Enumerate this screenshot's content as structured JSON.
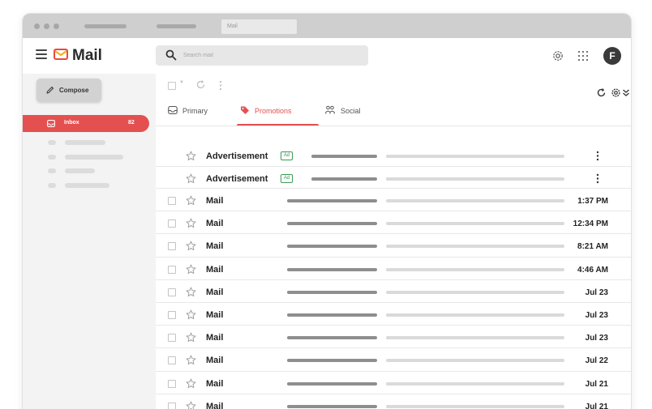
{
  "chrome": {
    "tab_title": "Mail"
  },
  "header": {
    "brand": "Mail",
    "search_placeholder": "Search mail",
    "avatar_letter": "F"
  },
  "sidebar": {
    "compose_label": "Compose",
    "inbox_label": "Inbox",
    "inbox_count": "82"
  },
  "tabs": [
    {
      "label": "Primary",
      "icon": "inbox-icon",
      "active": false
    },
    {
      "label": "Promotions",
      "icon": "tag-icon",
      "active": true
    },
    {
      "label": "Social",
      "icon": "people-icon",
      "active": false
    }
  ],
  "emails": [
    {
      "sender": "Advertisement",
      "ad_badge": "Ad",
      "time": "",
      "is_ad": true
    },
    {
      "sender": "Advertisement",
      "ad_badge": "Ad",
      "time": "",
      "is_ad": true
    },
    {
      "sender": "Mail",
      "time": "1:37 PM",
      "is_ad": false
    },
    {
      "sender": "Mail",
      "time": "12:34 PM",
      "is_ad": false
    },
    {
      "sender": "Mail",
      "time": "8:21 AM",
      "is_ad": false
    },
    {
      "sender": "Mail",
      "time": "4:46 AM",
      "is_ad": false
    },
    {
      "sender": "Mail",
      "time": "Jul 23",
      "is_ad": false
    },
    {
      "sender": "Mail",
      "time": "Jul 23",
      "is_ad": false
    },
    {
      "sender": "Mail",
      "time": "Jul 23",
      "is_ad": false
    },
    {
      "sender": "Mail",
      "time": "Jul 22",
      "is_ad": false
    },
    {
      "sender": "Mail",
      "time": "Jul 21",
      "is_ad": false
    },
    {
      "sender": "Mail",
      "time": "Jul 21",
      "is_ad": false
    }
  ],
  "colors": {
    "accent": "#e45050",
    "ad_badge": "#3c9a55",
    "logo_red": "#e84a3c",
    "logo_yellow": "#f2b019"
  }
}
